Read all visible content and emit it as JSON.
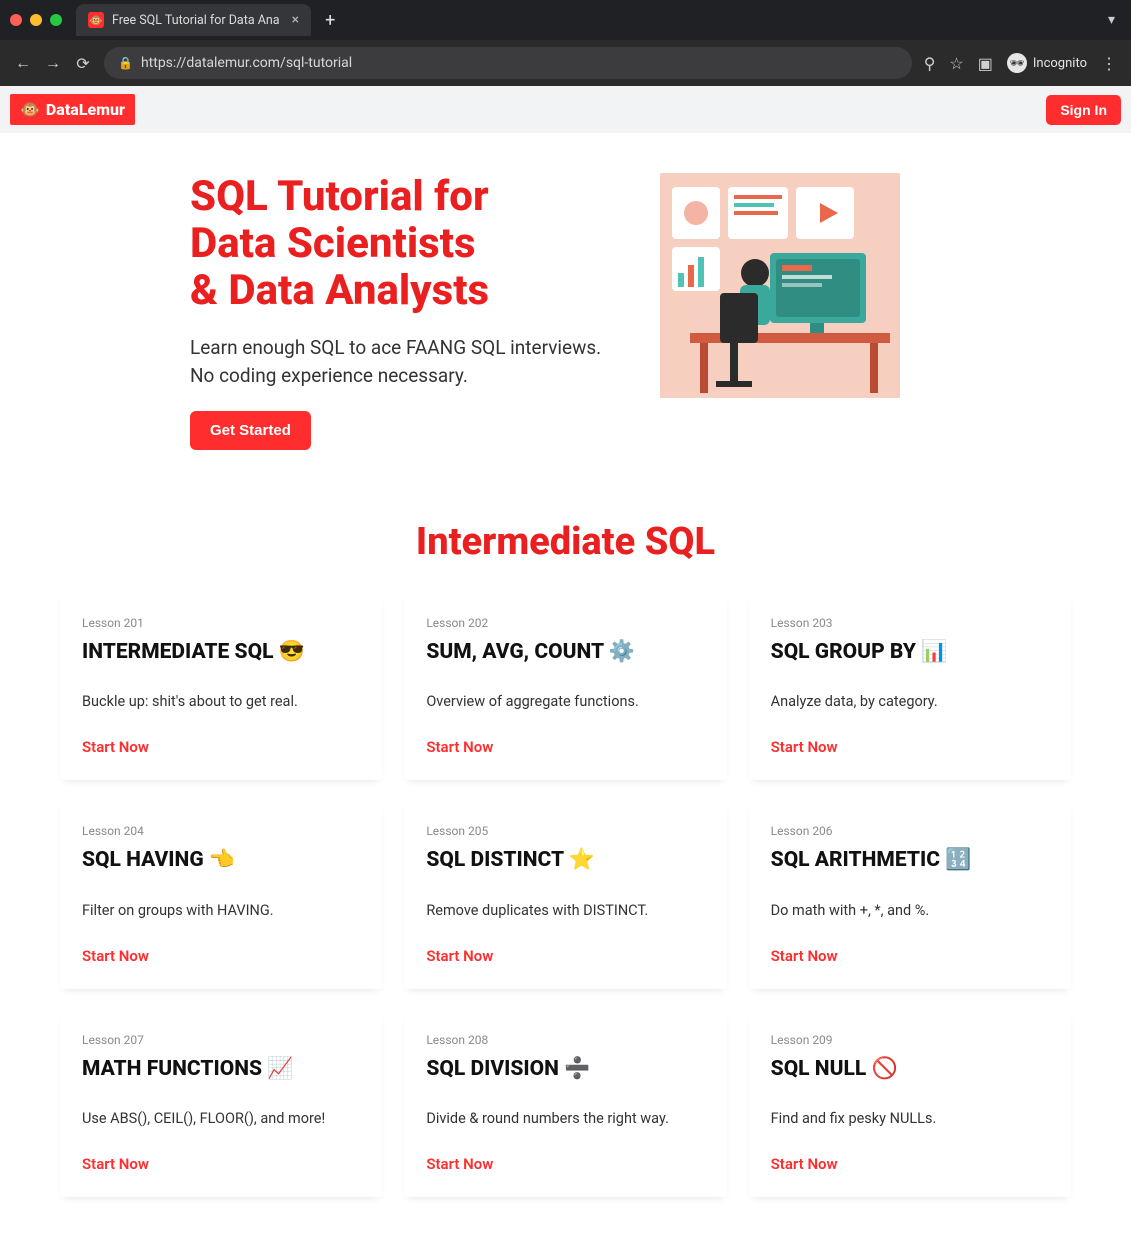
{
  "browser": {
    "tab_title": "Free SQL Tutorial for Data Ana",
    "url": "https://datalemur.com/sql-tutorial",
    "incognito_label": "Incognito"
  },
  "header": {
    "brand": "DataLemur",
    "signin": "Sign In"
  },
  "hero": {
    "title_l1": "SQL Tutorial for",
    "title_l2": "Data Scientists",
    "title_l3": "& Data Analysts",
    "subtitle": "Learn enough SQL to ace FAANG SQL interviews. No coding experience necessary.",
    "cta": "Get Started"
  },
  "section": {
    "title": "Intermediate SQL"
  },
  "lessons": [
    {
      "kicker": "Lesson 201",
      "title": "INTERMEDIATE SQL 😎",
      "desc": "Buckle up: shit's about to get real.",
      "link": "Start Now"
    },
    {
      "kicker": "Lesson 202",
      "title": "SUM, AVG, COUNT ⚙️",
      "desc": "Overview of aggregate functions.",
      "link": "Start Now"
    },
    {
      "kicker": "Lesson 203",
      "title": "SQL GROUP BY 📊",
      "desc": "Analyze data, by category.",
      "link": "Start Now"
    },
    {
      "kicker": "Lesson 204",
      "title": "SQL HAVING 👈",
      "desc": "Filter on groups with HAVING.",
      "link": "Start Now"
    },
    {
      "kicker": "Lesson 205",
      "title": "SQL DISTINCT ⭐",
      "desc": "Remove duplicates with DISTINCT.",
      "link": "Start Now"
    },
    {
      "kicker": "Lesson 206",
      "title": "SQL ARITHMETIC 🔢",
      "desc": "Do math with +, *, and %.",
      "link": "Start Now"
    },
    {
      "kicker": "Lesson 207",
      "title": "MATH FUNCTIONS 📈",
      "desc": "Use ABS(), CEIL(), FLOOR(), and more!",
      "link": "Start Now"
    },
    {
      "kicker": "Lesson 208",
      "title": "SQL DIVISION ➗",
      "desc": "Divide & round numbers the right way.",
      "link": "Start Now"
    },
    {
      "kicker": "Lesson 209",
      "title": "SQL NULL 🚫",
      "desc": "Find and fix pesky NULLs.",
      "link": "Start Now"
    }
  ]
}
